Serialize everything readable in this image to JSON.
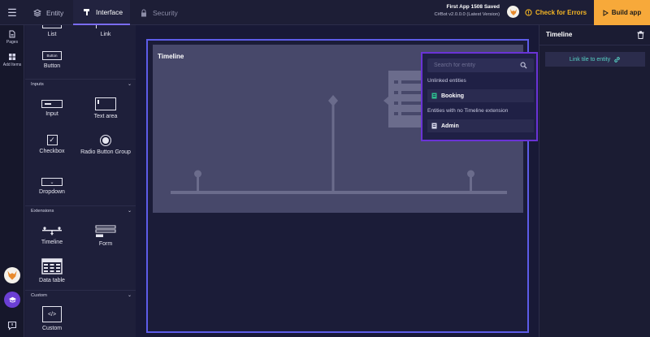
{
  "topbar": {
    "tabs": [
      {
        "label": "Entity",
        "icon": "layers-icon"
      },
      {
        "label": "Interface",
        "icon": "brush-icon"
      },
      {
        "label": "Security",
        "icon": "lock-icon"
      }
    ],
    "saved_text": "First App 1508 Saved",
    "version_text": "C#Bot v2.0.0.0   (Latest Version)",
    "check_errors_label": "Check for Errors",
    "build_app_label": "Build app",
    "accent": "#f7a93a"
  },
  "rail": {
    "pages_label": "Pages",
    "add_items_label": "Add Items"
  },
  "components": {
    "items_top": [
      {
        "label": "List"
      },
      {
        "label": "Link"
      }
    ],
    "button_label": "Button",
    "button_text": "Button",
    "inputs_section": "Inputs",
    "inputs": [
      {
        "label": "Input"
      },
      {
        "label": "Text area"
      },
      {
        "label": "Checkbox"
      },
      {
        "label": "Radio Button Group"
      },
      {
        "label": "Dropdown"
      }
    ],
    "extensions_section": "Extensions",
    "extensions": [
      {
        "label": "Timeline"
      },
      {
        "label": "Form"
      },
      {
        "label": "Data table"
      }
    ],
    "custom_section": "Custom",
    "custom": [
      {
        "label": "Custom"
      }
    ]
  },
  "canvas": {
    "timeline_title": "Timeline"
  },
  "entity_dropdown": {
    "search_placeholder": "Search for entity",
    "unlinked_label": "Unlinked entities",
    "unlinked_items": [
      {
        "label": "Booking"
      }
    ],
    "no_ext_label": "Entities with no Timeline extension",
    "no_ext_items": [
      {
        "label": "Admin"
      }
    ]
  },
  "right_panel": {
    "title": "Timeline",
    "link_tile_label": "Link tile to entity"
  }
}
